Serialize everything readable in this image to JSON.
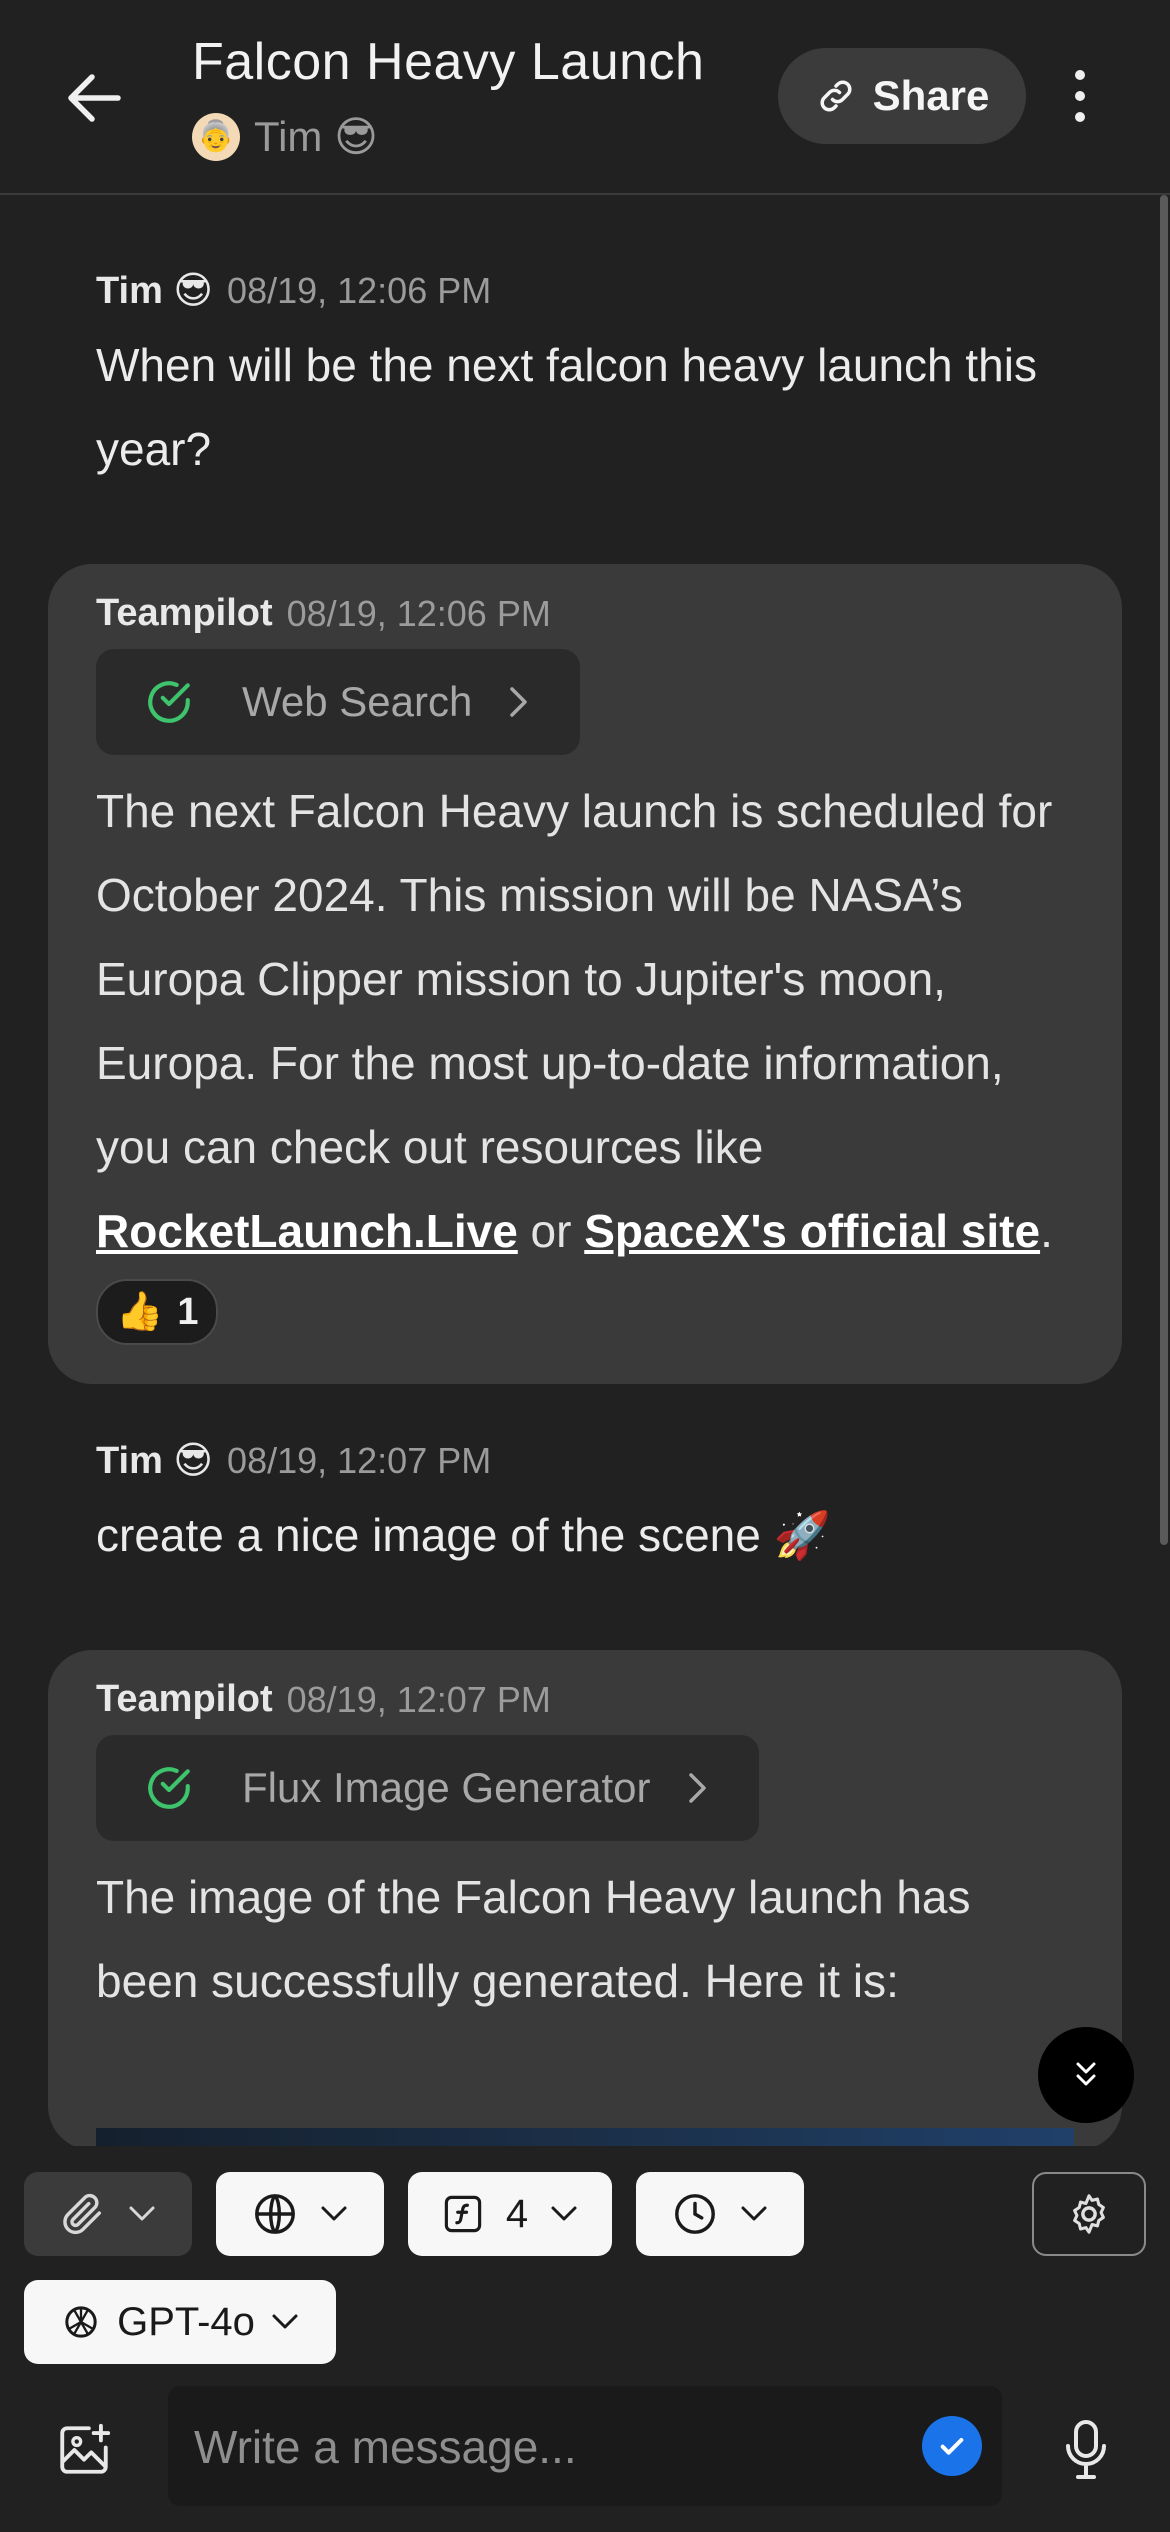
{
  "header": {
    "title": "Falcon Heavy Launch",
    "user_name": "Tim 😎",
    "share_label": "Share"
  },
  "messages": [
    {
      "author": "Tim 😎",
      "time": "08/19, 12:06 PM",
      "text": "When will be the next falcon heavy launch this year?"
    },
    {
      "author": "Teampilot",
      "time": "08/19, 12:06 PM",
      "tool": "Web Search",
      "text_before": "The next Falcon Heavy launch is scheduled for October 2024. This mission will be NASA’s Europa Clipper mission to Jupiter's moon, Europa. For the most up-to-date information, you can check out resources like ",
      "link1": "RocketLaunch.Live",
      "text_mid": " or ",
      "link2": "SpaceX's official site",
      "text_after": ".",
      "reaction_emoji": "👍",
      "reaction_count": "1"
    },
    {
      "author": "Tim 😎",
      "time": "08/19, 12:07 PM",
      "text": "create a nice image of the scene 🚀"
    },
    {
      "author": "Teampilot",
      "time": "08/19, 12:07 PM",
      "tool": "Flux Image Generator",
      "text": "The image of the Falcon Heavy launch has been successfully generated. Here it is:"
    }
  ],
  "toolbar": {
    "functions_count": "4",
    "model": "GPT-4o"
  },
  "composer": {
    "placeholder": "Write a message..."
  },
  "colors": {
    "background": "#212121",
    "bubble": "#3a3a3a",
    "success_green": "#3ec46d",
    "send_blue": "#1a73e8"
  }
}
